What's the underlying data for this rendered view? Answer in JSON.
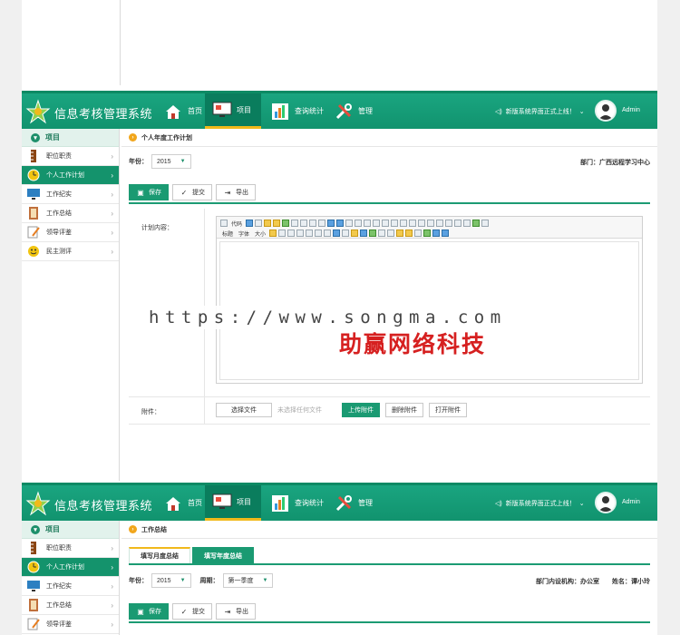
{
  "app": {
    "title": "信息考核管理系统",
    "nav": [
      {
        "label": "首页",
        "icon": "home-icon"
      },
      {
        "label": "项目",
        "icon": "monitor-icon"
      },
      {
        "label": "查询统计",
        "icon": "chart-icon"
      },
      {
        "label": "管理",
        "icon": "tools-icon"
      }
    ],
    "notice": "新版系统界面正式上线！",
    "user": "Admin"
  },
  "sidebar": {
    "heading": "项目",
    "items": [
      {
        "label": "职位职责",
        "icon": "ruler-icon"
      },
      {
        "label": "个人工作计划",
        "icon": "clock-icon"
      },
      {
        "label": "工作纪实",
        "icon": "screen-icon"
      },
      {
        "label": "工作总结",
        "icon": "notebook-icon"
      },
      {
        "label": "领导评鉴",
        "icon": "pencil-icon"
      },
      {
        "label": "民主测评",
        "icon": "smile-icon"
      }
    ]
  },
  "panel1": {
    "title": "个人年度工作计划",
    "year_label": "年份：",
    "year_value": "2015",
    "dept_label": "部门：",
    "dept_value": "广西远程学习中心",
    "buttons": {
      "save": "保存",
      "submit": "提交",
      "export": "导出"
    },
    "plan_label": "计划内容：",
    "editor_tools": {
      "code": "代码",
      "heading": "标题",
      "font": "字体",
      "size": "大小"
    },
    "attach_label": "附件：",
    "choose_file": "选择文件",
    "no_file": "未选择任何文件",
    "upload": "上传附件",
    "delete": "删除附件",
    "open": "打开附件"
  },
  "panel2": {
    "title": "工作总结",
    "tabs": [
      "填写月度总结",
      "填写年度总结"
    ],
    "year_label": "年份：",
    "year_value": "2015",
    "period_label": "周期：",
    "period_value": "第一季度",
    "org_label": "部门内设机构：",
    "org_value": "办公室",
    "name_label": "姓名：",
    "name_value": "谭小玲",
    "buttons": {
      "save": "保存",
      "submit": "提交",
      "export": "导出"
    }
  },
  "watermark": {
    "url": "https://www.songma.com",
    "brand": "助赢网络科技"
  },
  "colors": {
    "primary": "#1a9a72",
    "accent": "#f1b91b",
    "brand_red": "#d62020"
  }
}
